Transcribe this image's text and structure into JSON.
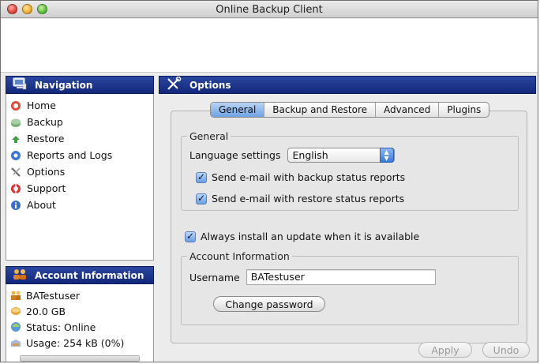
{
  "window": {
    "title": "Online Backup Client"
  },
  "sidebar": {
    "navigation_title": "Navigation",
    "nav_items": [
      {
        "label": "Home",
        "icon": "home-icon"
      },
      {
        "label": "Backup",
        "icon": "backup-icon"
      },
      {
        "label": "Restore",
        "icon": "restore-icon"
      },
      {
        "label": "Reports and Logs",
        "icon": "reports-icon"
      },
      {
        "label": "Options",
        "icon": "options-icon"
      },
      {
        "label": "Support",
        "icon": "support-icon"
      },
      {
        "label": "About",
        "icon": "about-icon"
      }
    ],
    "account_title": "Account Information",
    "account_items": [
      {
        "label": "BATestuser",
        "icon": "user-icon"
      },
      {
        "label": "20.0 GB",
        "icon": "storage-icon"
      },
      {
        "label": "Status: Online",
        "icon": "status-icon"
      },
      {
        "label": "Usage: 254 kB (0%)",
        "icon": "usage-icon"
      }
    ],
    "usage_fraction": 0.0
  },
  "main": {
    "title": "Options",
    "tabs": [
      {
        "label": "General",
        "active": true
      },
      {
        "label": "Backup and Restore",
        "active": false
      },
      {
        "label": "Advanced",
        "active": false
      },
      {
        "label": "Plugins",
        "active": false
      }
    ],
    "general": {
      "group_label": "General",
      "language_label": "Language settings",
      "language_value": "English",
      "email_backup_label": "Send e-mail with backup status reports",
      "email_backup_checked": true,
      "email_restore_label": "Send e-mail with restore status reports",
      "email_restore_checked": true
    },
    "auto_update_label": "Always install an update when it is available",
    "auto_update_checked": true,
    "account": {
      "group_label": "Account Information",
      "username_label": "Username",
      "username_value": "BATestuser",
      "change_password_label": "Change password"
    },
    "apply_label": "Apply",
    "undo_label": "Undo"
  },
  "colors": {
    "header_blue": "#12277a",
    "tab_active": "#6fa2e4",
    "checkbox_blue": "#6a9ee4"
  }
}
